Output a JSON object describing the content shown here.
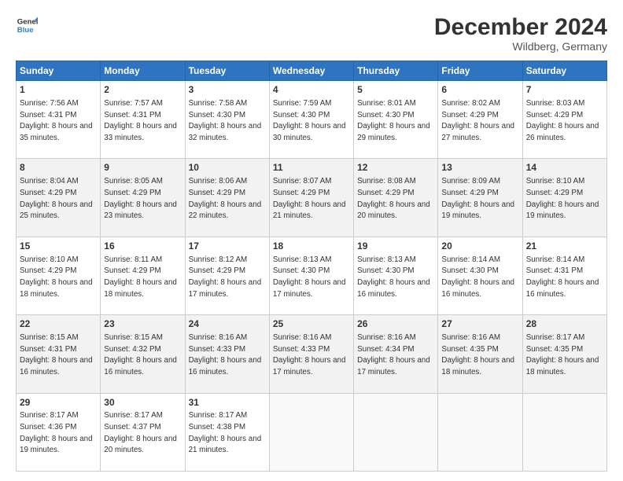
{
  "header": {
    "logo_line1": "General",
    "logo_line2": "Blue",
    "title": "December 2024",
    "subtitle": "Wildberg, Germany"
  },
  "days_of_week": [
    "Sunday",
    "Monday",
    "Tuesday",
    "Wednesday",
    "Thursday",
    "Friday",
    "Saturday"
  ],
  "weeks": [
    [
      {
        "day": 1,
        "sunrise": "7:56 AM",
        "sunset": "4:31 PM",
        "daylight": "8 hours and 35 minutes."
      },
      {
        "day": 2,
        "sunrise": "7:57 AM",
        "sunset": "4:31 PM",
        "daylight": "8 hours and 33 minutes."
      },
      {
        "day": 3,
        "sunrise": "7:58 AM",
        "sunset": "4:30 PM",
        "daylight": "8 hours and 32 minutes."
      },
      {
        "day": 4,
        "sunrise": "7:59 AM",
        "sunset": "4:30 PM",
        "daylight": "8 hours and 30 minutes."
      },
      {
        "day": 5,
        "sunrise": "8:01 AM",
        "sunset": "4:30 PM",
        "daylight": "8 hours and 29 minutes."
      },
      {
        "day": 6,
        "sunrise": "8:02 AM",
        "sunset": "4:29 PM",
        "daylight": "8 hours and 27 minutes."
      },
      {
        "day": 7,
        "sunrise": "8:03 AM",
        "sunset": "4:29 PM",
        "daylight": "8 hours and 26 minutes."
      }
    ],
    [
      {
        "day": 8,
        "sunrise": "8:04 AM",
        "sunset": "4:29 PM",
        "daylight": "8 hours and 25 minutes."
      },
      {
        "day": 9,
        "sunrise": "8:05 AM",
        "sunset": "4:29 PM",
        "daylight": "8 hours and 23 minutes."
      },
      {
        "day": 10,
        "sunrise": "8:06 AM",
        "sunset": "4:29 PM",
        "daylight": "8 hours and 22 minutes."
      },
      {
        "day": 11,
        "sunrise": "8:07 AM",
        "sunset": "4:29 PM",
        "daylight": "8 hours and 21 minutes."
      },
      {
        "day": 12,
        "sunrise": "8:08 AM",
        "sunset": "4:29 PM",
        "daylight": "8 hours and 20 minutes."
      },
      {
        "day": 13,
        "sunrise": "8:09 AM",
        "sunset": "4:29 PM",
        "daylight": "8 hours and 19 minutes."
      },
      {
        "day": 14,
        "sunrise": "8:10 AM",
        "sunset": "4:29 PM",
        "daylight": "8 hours and 19 minutes."
      }
    ],
    [
      {
        "day": 15,
        "sunrise": "8:10 AM",
        "sunset": "4:29 PM",
        "daylight": "8 hours and 18 minutes."
      },
      {
        "day": 16,
        "sunrise": "8:11 AM",
        "sunset": "4:29 PM",
        "daylight": "8 hours and 18 minutes."
      },
      {
        "day": 17,
        "sunrise": "8:12 AM",
        "sunset": "4:29 PM",
        "daylight": "8 hours and 17 minutes."
      },
      {
        "day": 18,
        "sunrise": "8:13 AM",
        "sunset": "4:30 PM",
        "daylight": "8 hours and 17 minutes."
      },
      {
        "day": 19,
        "sunrise": "8:13 AM",
        "sunset": "4:30 PM",
        "daylight": "8 hours and 16 minutes."
      },
      {
        "day": 20,
        "sunrise": "8:14 AM",
        "sunset": "4:30 PM",
        "daylight": "8 hours and 16 minutes."
      },
      {
        "day": 21,
        "sunrise": "8:14 AM",
        "sunset": "4:31 PM",
        "daylight": "8 hours and 16 minutes."
      }
    ],
    [
      {
        "day": 22,
        "sunrise": "8:15 AM",
        "sunset": "4:31 PM",
        "daylight": "8 hours and 16 minutes."
      },
      {
        "day": 23,
        "sunrise": "8:15 AM",
        "sunset": "4:32 PM",
        "daylight": "8 hours and 16 minutes."
      },
      {
        "day": 24,
        "sunrise": "8:16 AM",
        "sunset": "4:33 PM",
        "daylight": "8 hours and 16 minutes."
      },
      {
        "day": 25,
        "sunrise": "8:16 AM",
        "sunset": "4:33 PM",
        "daylight": "8 hours and 17 minutes."
      },
      {
        "day": 26,
        "sunrise": "8:16 AM",
        "sunset": "4:34 PM",
        "daylight": "8 hours and 17 minutes."
      },
      {
        "day": 27,
        "sunrise": "8:16 AM",
        "sunset": "4:35 PM",
        "daylight": "8 hours and 18 minutes."
      },
      {
        "day": 28,
        "sunrise": "8:17 AM",
        "sunset": "4:35 PM",
        "daylight": "8 hours and 18 minutes."
      }
    ],
    [
      {
        "day": 29,
        "sunrise": "8:17 AM",
        "sunset": "4:36 PM",
        "daylight": "8 hours and 19 minutes."
      },
      {
        "day": 30,
        "sunrise": "8:17 AM",
        "sunset": "4:37 PM",
        "daylight": "8 hours and 20 minutes."
      },
      {
        "day": 31,
        "sunrise": "8:17 AM",
        "sunset": "4:38 PM",
        "daylight": "8 hours and 21 minutes."
      },
      null,
      null,
      null,
      null
    ]
  ]
}
